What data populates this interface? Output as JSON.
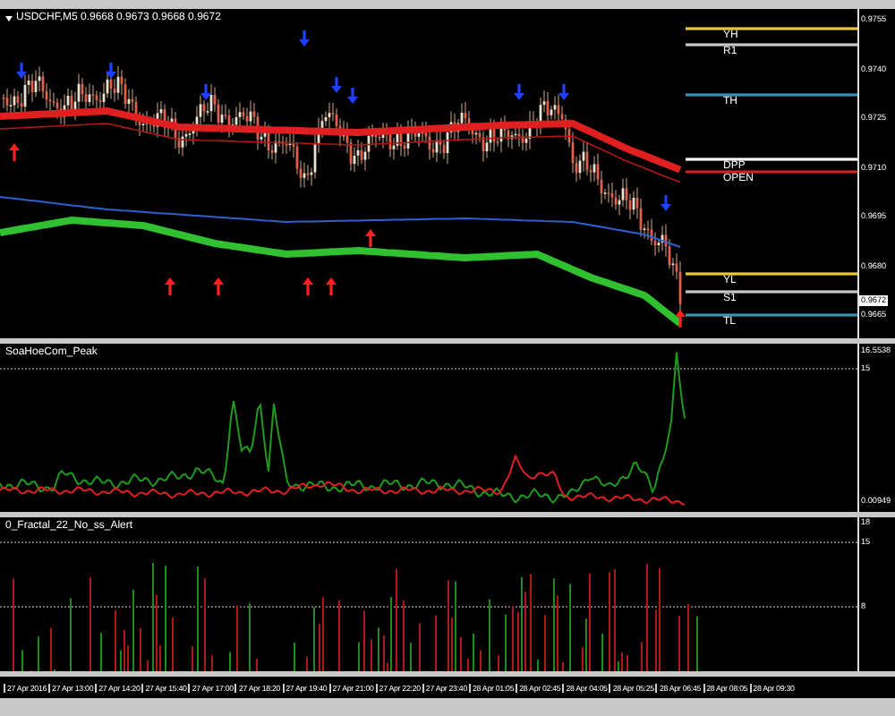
{
  "chart": {
    "title": "USDCHF,M5 0.9668 0.9673 0.9668 0.9672",
    "price_axis": [
      "0.9755",
      "0.9740",
      "0.9725",
      "0.9710",
      "0.9695",
      "0.9680",
      "0.9665"
    ],
    "current_price": "0.9672",
    "levels": [
      {
        "label": "YH",
        "color": "#e8c840"
      },
      {
        "label": "R1",
        "color": "#c8c8c8"
      },
      {
        "label": "TH",
        "color": "#3a90b0"
      },
      {
        "label": "DPP",
        "color": "#ffffff"
      },
      {
        "label": "OPEN",
        "color": "#d02020"
      },
      {
        "label": "YL",
        "color": "#e8c840"
      },
      {
        "label": "S1",
        "color": "#c8c8c8"
      },
      {
        "label": "TL",
        "color": "#3a90b0"
      }
    ]
  },
  "indicators": [
    {
      "title": "SoaHoeCom_Peak",
      "axis": [
        "16.5538",
        "15",
        "0.00949"
      ]
    },
    {
      "title": "0_Fractal_22_No_ss_Alert",
      "axis": [
        "18",
        "15",
        "8"
      ]
    }
  ],
  "time_axis": [
    "27 Apr 2016",
    "27 Apr 13:00",
    "27 Apr 14:20",
    "27 Apr 15:40",
    "27 Apr 17:00",
    "27 Apr 18:20",
    "27 Apr 19:40",
    "27 Apr 21:00",
    "27 Apr 22:20",
    "27 Apr 23:40",
    "28 Apr 01:05",
    "28 Apr 02:45",
    "28 Apr 04:05",
    "28 Apr 05:25",
    "28 Apr 06:45",
    "28 Apr 08:05",
    "28 Apr 09:30"
  ]
}
